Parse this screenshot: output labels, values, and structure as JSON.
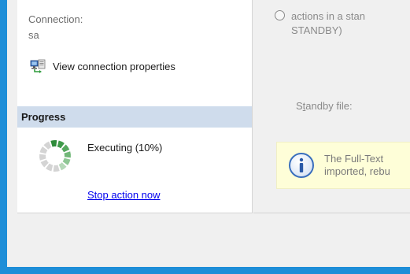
{
  "connection": {
    "label": "Connection:",
    "value": "sa",
    "view_properties_label": "View connection properties",
    "view_properties_icon": "connection-properties-icon"
  },
  "progress": {
    "header": "Progress",
    "status": "Executing (10%)",
    "percent": 10,
    "stop_link": "Stop action now",
    "spinner_icon": "progress-spinner-icon"
  },
  "options": {
    "radio_line1": "actions in a stan",
    "radio_line2": "STANDBY)",
    "standby_file_label_pre": "S",
    "standby_file_label_mn": "t",
    "standby_file_label_post": "andby file:"
  },
  "info": {
    "icon": "info-icon",
    "line1": "The Full-Text",
    "line2": "imported, rebu"
  },
  "colors": {
    "link": "#0000ee",
    "progress_header_bg": "#cfdcec",
    "info_bg": "#fefed8",
    "spinner_active": "#2e8b3a",
    "window_border": "#1e8ed8"
  }
}
